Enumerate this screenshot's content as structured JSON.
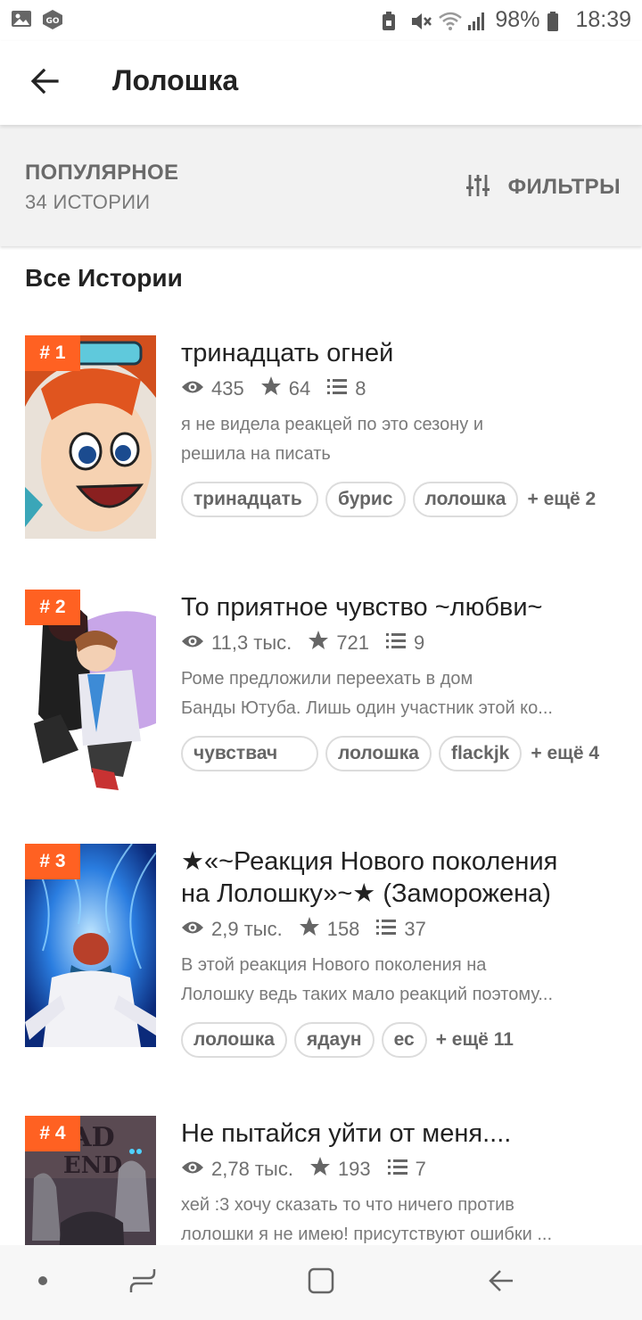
{
  "status_bar": {
    "left_icons": [
      "image-icon",
      "go-icon"
    ],
    "right_icons": [
      "lock-icon",
      "mute-icon",
      "wifi-icon",
      "signal-icon"
    ],
    "battery": "98%",
    "time": "18:39"
  },
  "app_bar": {
    "back_icon": "arrow-left-icon",
    "title": "Лолошка"
  },
  "filter": {
    "heading": "ПОПУЛЯРНОЕ",
    "count": "34 ИСТОРИИ",
    "button_icon": "sliders-icon",
    "button_label": "ФИЛЬТРЫ"
  },
  "section_title": "Все Истории",
  "stories": [
    {
      "rank": "# 1",
      "title": "тринадцать огней",
      "views": "435",
      "votes": "64",
      "parts": "8",
      "desc_lines": [
        "я не видела реакцей по это сезону и",
        "решила на писать"
      ],
      "tags": [
        "тринадцать",
        "бурис",
        "лолошка"
      ],
      "more": "+ ещё 2"
    },
    {
      "rank": "# 2",
      "title": "То приятное чувство ~любви~",
      "views": "11,3 тыс.",
      "votes": "721",
      "parts": "9",
      "desc_lines": [
        "Роме предложили переехать в дом",
        "Банды Ютуба. Лишь один участник этой ко..."
      ],
      "tags": [
        "чувствач",
        "лолошка",
        "flackjk"
      ],
      "more": "+ ещё 4"
    },
    {
      "rank": "# 3",
      "title_lines": [
        "★«~Реакция Нового поколения",
        "на Лолошку»~★ (Заморожена)"
      ],
      "views": "2,9 тыс.",
      "votes": "158",
      "parts": "37",
      "desc_lines": [
        "В этой реакция Нового поколения на",
        "Лолошку ведь таких мало реакций поэтому..."
      ],
      "tags": [
        "лолошка",
        "ядаун",
        "ес"
      ],
      "more": "+ ещё 11"
    },
    {
      "rank": "# 4",
      "title": "Не пытайся уйти от меня....",
      "views": "2,78 тыс.",
      "votes": "193",
      "parts": "7",
      "desc_lines": [
        "хей :3 хочу сказать то что ничего против",
        "лолошки я не имею! присутствуют ошибки ..."
      ],
      "cover_text": [
        "AD",
        "END"
      ]
    }
  ],
  "nav_bar": {
    "icons": [
      "dot-icon",
      "recent-apps-icon",
      "home-icon",
      "back-nav-icon"
    ]
  },
  "colors": {
    "accent": "#ff6122",
    "text": "#222222",
    "muted": "#7a7a7a"
  }
}
